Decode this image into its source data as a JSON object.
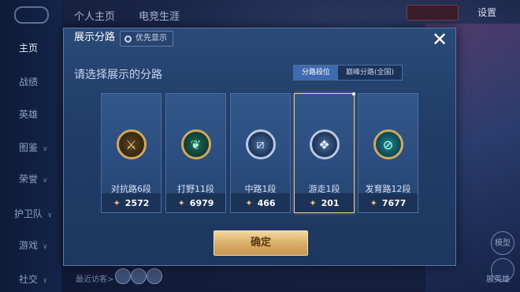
{
  "background": {
    "tabs": [
      "个人主页",
      "电竞生涯"
    ],
    "settings_label": "设置",
    "nav": [
      {
        "label": "主页",
        "chevron": ""
      },
      {
        "label": "战绩",
        "chevron": ""
      },
      {
        "label": "英雄",
        "chevron": ""
      },
      {
        "label": "图鉴",
        "chevron": "∨"
      },
      {
        "label": "荣誉",
        "chevron": "∨"
      },
      {
        "label": "护卫队",
        "chevron": "∨"
      },
      {
        "label": "游戏",
        "chevron": "∨"
      },
      {
        "label": "社交",
        "chevron": "∨"
      }
    ],
    "visitor_label": "最近访客>",
    "right_labels": [
      "模型",
      "展英雄"
    ]
  },
  "dialog": {
    "title": "展示分路",
    "priority_button": "优先显示",
    "close_icon": "✕",
    "heading": "请选择展示的分路",
    "segments": [
      {
        "label": "分路段位",
        "active": true
      },
      {
        "label": "巅峰分路(全国)",
        "active": false
      }
    ],
    "cards": [
      {
        "label": "对抗路6段",
        "value": "2572",
        "icon": "sword-emblem-icon",
        "glyph": "⚔",
        "style": "gold",
        "selected": false
      },
      {
        "label": "打野11段",
        "value": "6979",
        "icon": "dragon-emblem-icon",
        "glyph": "❦",
        "style": "green",
        "selected": false
      },
      {
        "label": "中路1段",
        "value": "466",
        "icon": "staff-emblem-icon",
        "glyph": "⧄",
        "style": "silver",
        "selected": false
      },
      {
        "label": "游走1段",
        "value": "201",
        "icon": "wing-emblem-icon",
        "glyph": "❖",
        "style": "silver",
        "selected": true
      },
      {
        "label": "发育路12段",
        "value": "7677",
        "icon": "bow-emblem-icon",
        "glyph": "⊘",
        "style": "teal",
        "selected": false
      }
    ],
    "stat_icon": "✦",
    "confirm_label": "确定"
  }
}
